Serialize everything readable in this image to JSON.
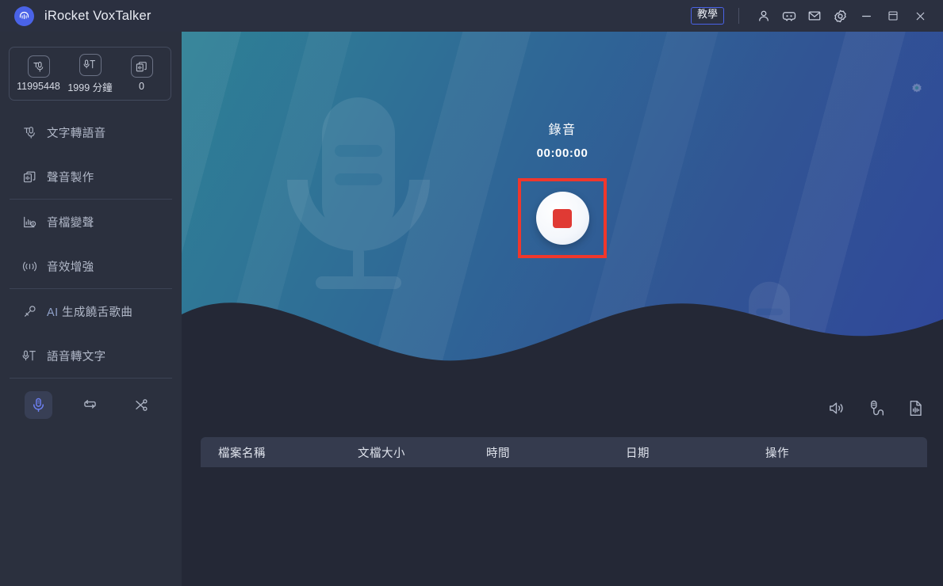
{
  "window": {
    "app_title": "iRocket VoxTalker",
    "logo_icon": "headphone-waveform-icon",
    "tutorial_label": "教學",
    "icons": {
      "account": "user-icon",
      "discord": "discord-icon",
      "mail": "mail-icon",
      "settings": "gear-icon",
      "minimize": "minimize-icon",
      "maximize": "maximize-icon",
      "close": "close-icon"
    }
  },
  "sidebar": {
    "credits": [
      {
        "icon": "text-to-speech-credit-icon",
        "value": "11995448"
      },
      {
        "icon": "speech-to-text-credit-icon",
        "value": "1999 分鐘"
      },
      {
        "icon": "voice-clone-credit-icon",
        "value": "0"
      }
    ],
    "items": [
      {
        "icon": "text-to-speech-icon",
        "label": "文字轉語音"
      },
      {
        "icon": "voice-studio-icon",
        "label": "聲音製作"
      },
      {
        "icon": "audio-voice-changer-icon",
        "label": "音檔變聲"
      },
      {
        "icon": "audio-enhance-icon",
        "label": "音效增強"
      },
      {
        "icon": "ai-rap-icon",
        "label_prefix": "AI",
        "label": "生成饒舌歌曲"
      },
      {
        "icon": "speech-to-text-icon",
        "label": "語音轉文字"
      }
    ],
    "tools": [
      {
        "icon": "microphone-record-icon",
        "active": true
      },
      {
        "icon": "loop-repeat-icon",
        "active": false
      },
      {
        "icon": "scissors-cut-icon",
        "active": false
      }
    ]
  },
  "main": {
    "hero": {
      "gear_icon": "gear-icon",
      "watermark_icon": "microphone-watermark-icon",
      "record_title": "錄音",
      "record_time": "00:00:00",
      "record_button_icon": "stop-square-icon",
      "highlight_color": "#f0372c"
    },
    "list_tools": [
      {
        "icon": "speaker-volume-icon"
      },
      {
        "icon": "microphone-input-icon"
      },
      {
        "icon": "audio-file-icon"
      }
    ],
    "table": {
      "columns": [
        "檔案名稱",
        "文檔大小",
        "時間",
        "日期",
        "操作"
      ],
      "rows": []
    }
  },
  "colors": {
    "sidebar_bg": "#2b303e",
    "main_bg": "#242836",
    "titlebar_bg": "#2b3040",
    "accent": "#4a63e7",
    "record_red": "#e03a34",
    "highlight_red": "#f0372c",
    "hero_gradient_start": "#2e8095",
    "hero_gradient_end": "#30479a"
  }
}
